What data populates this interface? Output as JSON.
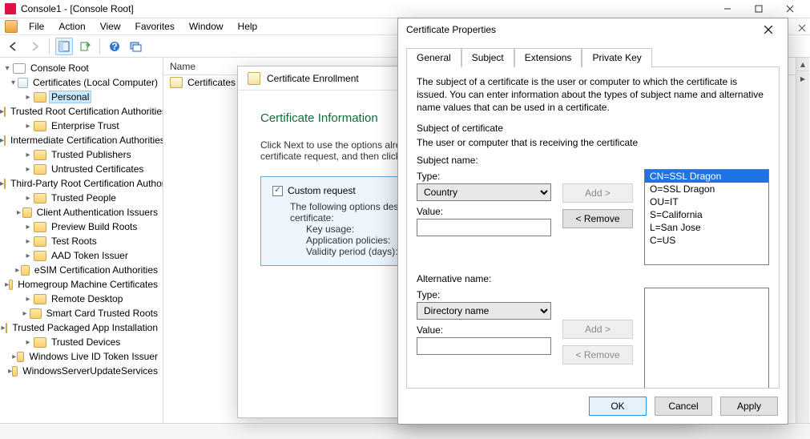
{
  "window": {
    "title": "Console1 - [Console Root]"
  },
  "menus": [
    "File",
    "Action",
    "View",
    "Favorites",
    "Window",
    "Help"
  ],
  "tree": {
    "root": "Console Root",
    "certs_node": "Certificates (Local Computer)",
    "selected": "Personal",
    "items": [
      "Personal",
      "Trusted Root Certification Authorities",
      "Enterprise Trust",
      "Intermediate Certification Authorities",
      "Trusted Publishers",
      "Untrusted Certificates",
      "Third-Party Root Certification Authorities",
      "Trusted People",
      "Client Authentication Issuers",
      "Preview Build Roots",
      "Test Roots",
      "AAD Token Issuer",
      "eSIM Certification Authorities",
      "Homegroup Machine Certificates",
      "Remote Desktop",
      "Smart Card Trusted Roots",
      "Trusted Packaged App Installation",
      "Trusted Devices",
      "Windows Live ID Token Issuer",
      "WindowsServerUpdateServices"
    ]
  },
  "list": {
    "header": "Name",
    "rows": [
      "Certificates"
    ]
  },
  "wizard": {
    "title": "Certificate Enrollment",
    "heading": "Certificate Information",
    "instr": "Click Next to use the options already selected for this template, or click Details to customize the certificate request, and then click Next.",
    "opt_label": "Custom request",
    "sub1": "The following options describe the uses and validity period that apply to this type of certificate:",
    "kv1": "Key usage:",
    "kv2": "Application policies:",
    "kv3": "Validity period (days):"
  },
  "dialog": {
    "title": "Certificate Properties",
    "tabs": [
      "General",
      "Subject",
      "Extensions",
      "Private Key"
    ],
    "active_tab": "Subject",
    "desc": "The subject of a certificate is the user or computer to which the certificate is issued. You can enter information about the types of subject name and alternative name values that can be used in a certificate.",
    "section1": "Subject of certificate",
    "section1_sub": "The user or computer that is receiving the certificate",
    "subj_name_h": "Subject name:",
    "type_lbl": "Type:",
    "value_lbl": "Value:",
    "subj_type": "Country",
    "subj_value": "",
    "alt_h": "Alternative name:",
    "alt_type": "Directory name",
    "alt_value": "",
    "add_btn": "Add >",
    "remove_btn": "< Remove",
    "subject_list": [
      "CN=SSL Dragon",
      "O=SSL Dragon",
      "OU=IT",
      "S=California",
      "L=San Jose",
      "C=US"
    ],
    "ok": "OK",
    "cancel": "Cancel",
    "apply": "Apply"
  }
}
